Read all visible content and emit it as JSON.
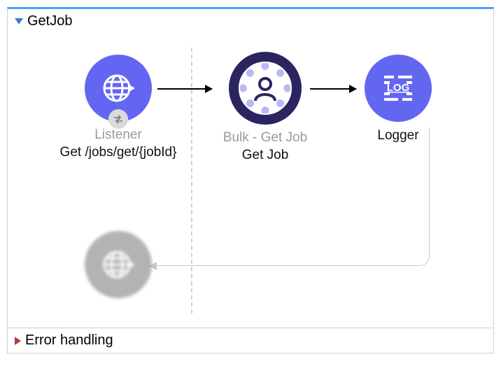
{
  "flow": {
    "title": "GetJob",
    "nodes": {
      "listener": {
        "type_label": "Listener",
        "name": "Get /jobs/get/{jobId}",
        "icon": "globe-arrow"
      },
      "bulk": {
        "type_label": "Bulk - Get Job",
        "name": "Get Job",
        "icon": "person-ring"
      },
      "logger": {
        "type_label": "Logger",
        "name": "",
        "icon": "log"
      },
      "response": {
        "icon": "globe-arrow"
      }
    }
  },
  "error_section": {
    "title": "Error handling"
  }
}
